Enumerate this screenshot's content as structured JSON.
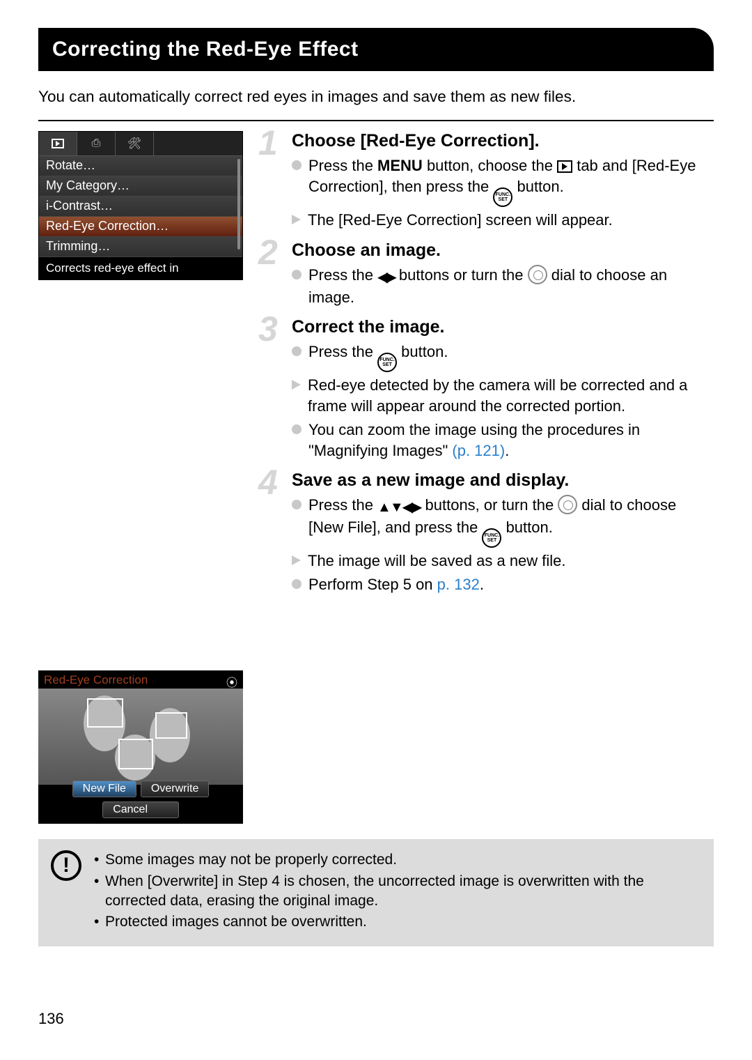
{
  "title": "Correcting the Red-Eye Effect",
  "intro": "You can automatically correct red eyes in images and save them as new files.",
  "camera_menu": {
    "items": [
      "Rotate…",
      "My Category…",
      "i-Contrast…",
      "Red-Eye Correction…",
      "Trimming…"
    ],
    "selected_index": 3,
    "description": "Corrects red-eye effect in"
  },
  "steps": [
    {
      "num": "1",
      "title": "Choose [Red-Eye Correction].",
      "lines": [
        {
          "type": "dot",
          "parts": [
            {
              "t": "Press the "
            },
            {
              "icon": "menu"
            },
            {
              "t": " button, choose the "
            },
            {
              "icon": "playbox"
            },
            {
              "t": " tab and [Red-Eye Correction], then press the "
            },
            {
              "icon": "funcset"
            },
            {
              "t": " button."
            }
          ]
        },
        {
          "type": "tri",
          "parts": [
            {
              "t": "The [Red-Eye Correction] screen will appear."
            }
          ]
        }
      ]
    },
    {
      "num": "2",
      "title": "Choose an image.",
      "lines": [
        {
          "type": "dot",
          "parts": [
            {
              "t": "Press the "
            },
            {
              "icon": "lr"
            },
            {
              "t": " buttons or turn the "
            },
            {
              "icon": "dial"
            },
            {
              "t": " dial to choose an image."
            }
          ]
        }
      ]
    },
    {
      "num": "3",
      "title": "Correct the image.",
      "lines": [
        {
          "type": "dot",
          "parts": [
            {
              "t": "Press the "
            },
            {
              "icon": "funcset"
            },
            {
              "t": " button."
            }
          ]
        },
        {
          "type": "tri",
          "parts": [
            {
              "t": "Red-eye detected by the camera will be corrected and a frame will appear around the corrected portion."
            }
          ]
        },
        {
          "type": "dot",
          "parts": [
            {
              "t": "You can zoom the image using the procedures in \"Magnifying Images\" "
            },
            {
              "link": "(p. 121)"
            },
            {
              "t": "."
            }
          ]
        }
      ]
    },
    {
      "num": "4",
      "title": "Save as a new image and display.",
      "lines": [
        {
          "type": "dot",
          "parts": [
            {
              "t": "Press the "
            },
            {
              "icon": "udlr"
            },
            {
              "t": " buttons, or turn the "
            },
            {
              "icon": "dial"
            },
            {
              "t": " dial to choose [New File], and press the "
            },
            {
              "icon": "funcset"
            },
            {
              "t": " button."
            }
          ]
        },
        {
          "type": "tri",
          "parts": [
            {
              "t": "The image will be saved as a new file."
            }
          ]
        },
        {
          "type": "dot",
          "parts": [
            {
              "t": "Perform Step 5 on "
            },
            {
              "link": "p. 132"
            },
            {
              "t": "."
            }
          ]
        }
      ]
    }
  ],
  "save_dialog": {
    "title": "Red-Eye Correction",
    "buttons": [
      "New File",
      "Overwrite",
      "Cancel"
    ],
    "selected": 0
  },
  "caution": [
    "Some images may not be properly corrected.",
    "When [Overwrite] in Step 4 is chosen, the uncorrected image is overwritten with the corrected data, erasing the original image.",
    "Protected images cannot be overwritten."
  ],
  "page_number": "136",
  "icon_text": {
    "menu": "MENU",
    "func": "FUNC.",
    "set": "SET"
  }
}
